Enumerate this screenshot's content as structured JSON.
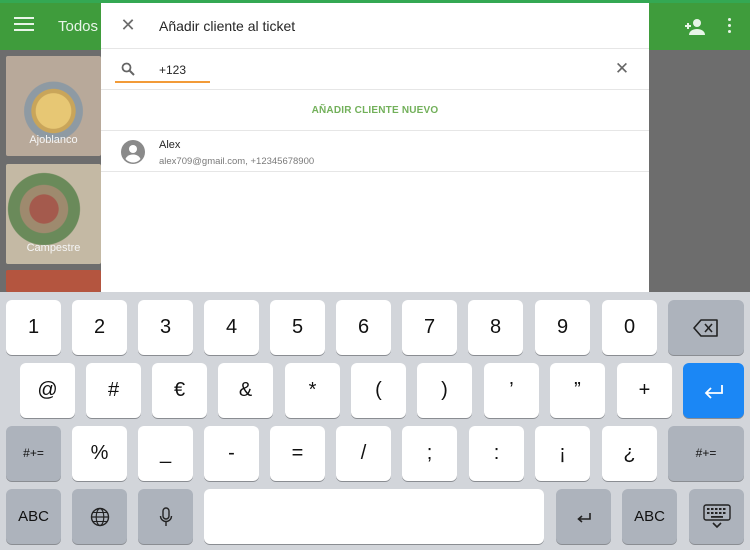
{
  "app_bar": {
    "title": "Todos",
    "menu_icon": "hamburger-menu-icon",
    "add_icon": "add-person-icon",
    "more_icon": "more-vert-icon",
    "color": "#3f9c3c"
  },
  "tiles": [
    {
      "label": "Ajoblanco"
    },
    {
      "label": "Campestre"
    }
  ],
  "dialog": {
    "title": "Añadir cliente al ticket",
    "search": {
      "value": "+123",
      "placeholder": ""
    },
    "add_new_label": "AÑADIR CLIENTE NUEVO",
    "accent_color": "#72b05a",
    "clients": [
      {
        "name": "Alex",
        "detail": "alex709@gmail.com, +12345678900"
      }
    ]
  },
  "keyboard": {
    "row1": [
      "1",
      "2",
      "3",
      "4",
      "5",
      "6",
      "7",
      "8",
      "9",
      "0"
    ],
    "row2": [
      "@",
      "#",
      "€",
      "&",
      "*",
      "(",
      ")",
      "’",
      "”",
      "+"
    ],
    "row3_left": "#+=",
    "row3": [
      "%",
      "_",
      "-",
      "=",
      "/",
      ";",
      ":",
      "¡",
      "¿"
    ],
    "row3_right": "#+=",
    "row4_left": "ABC",
    "row4_right": "ABC",
    "icons": {
      "backspace": "backspace-icon",
      "return": "return-icon",
      "globe": "globe-icon",
      "mic": "microphone-icon",
      "undo": "undo-icon",
      "hide": "keyboard-hide-icon"
    }
  }
}
